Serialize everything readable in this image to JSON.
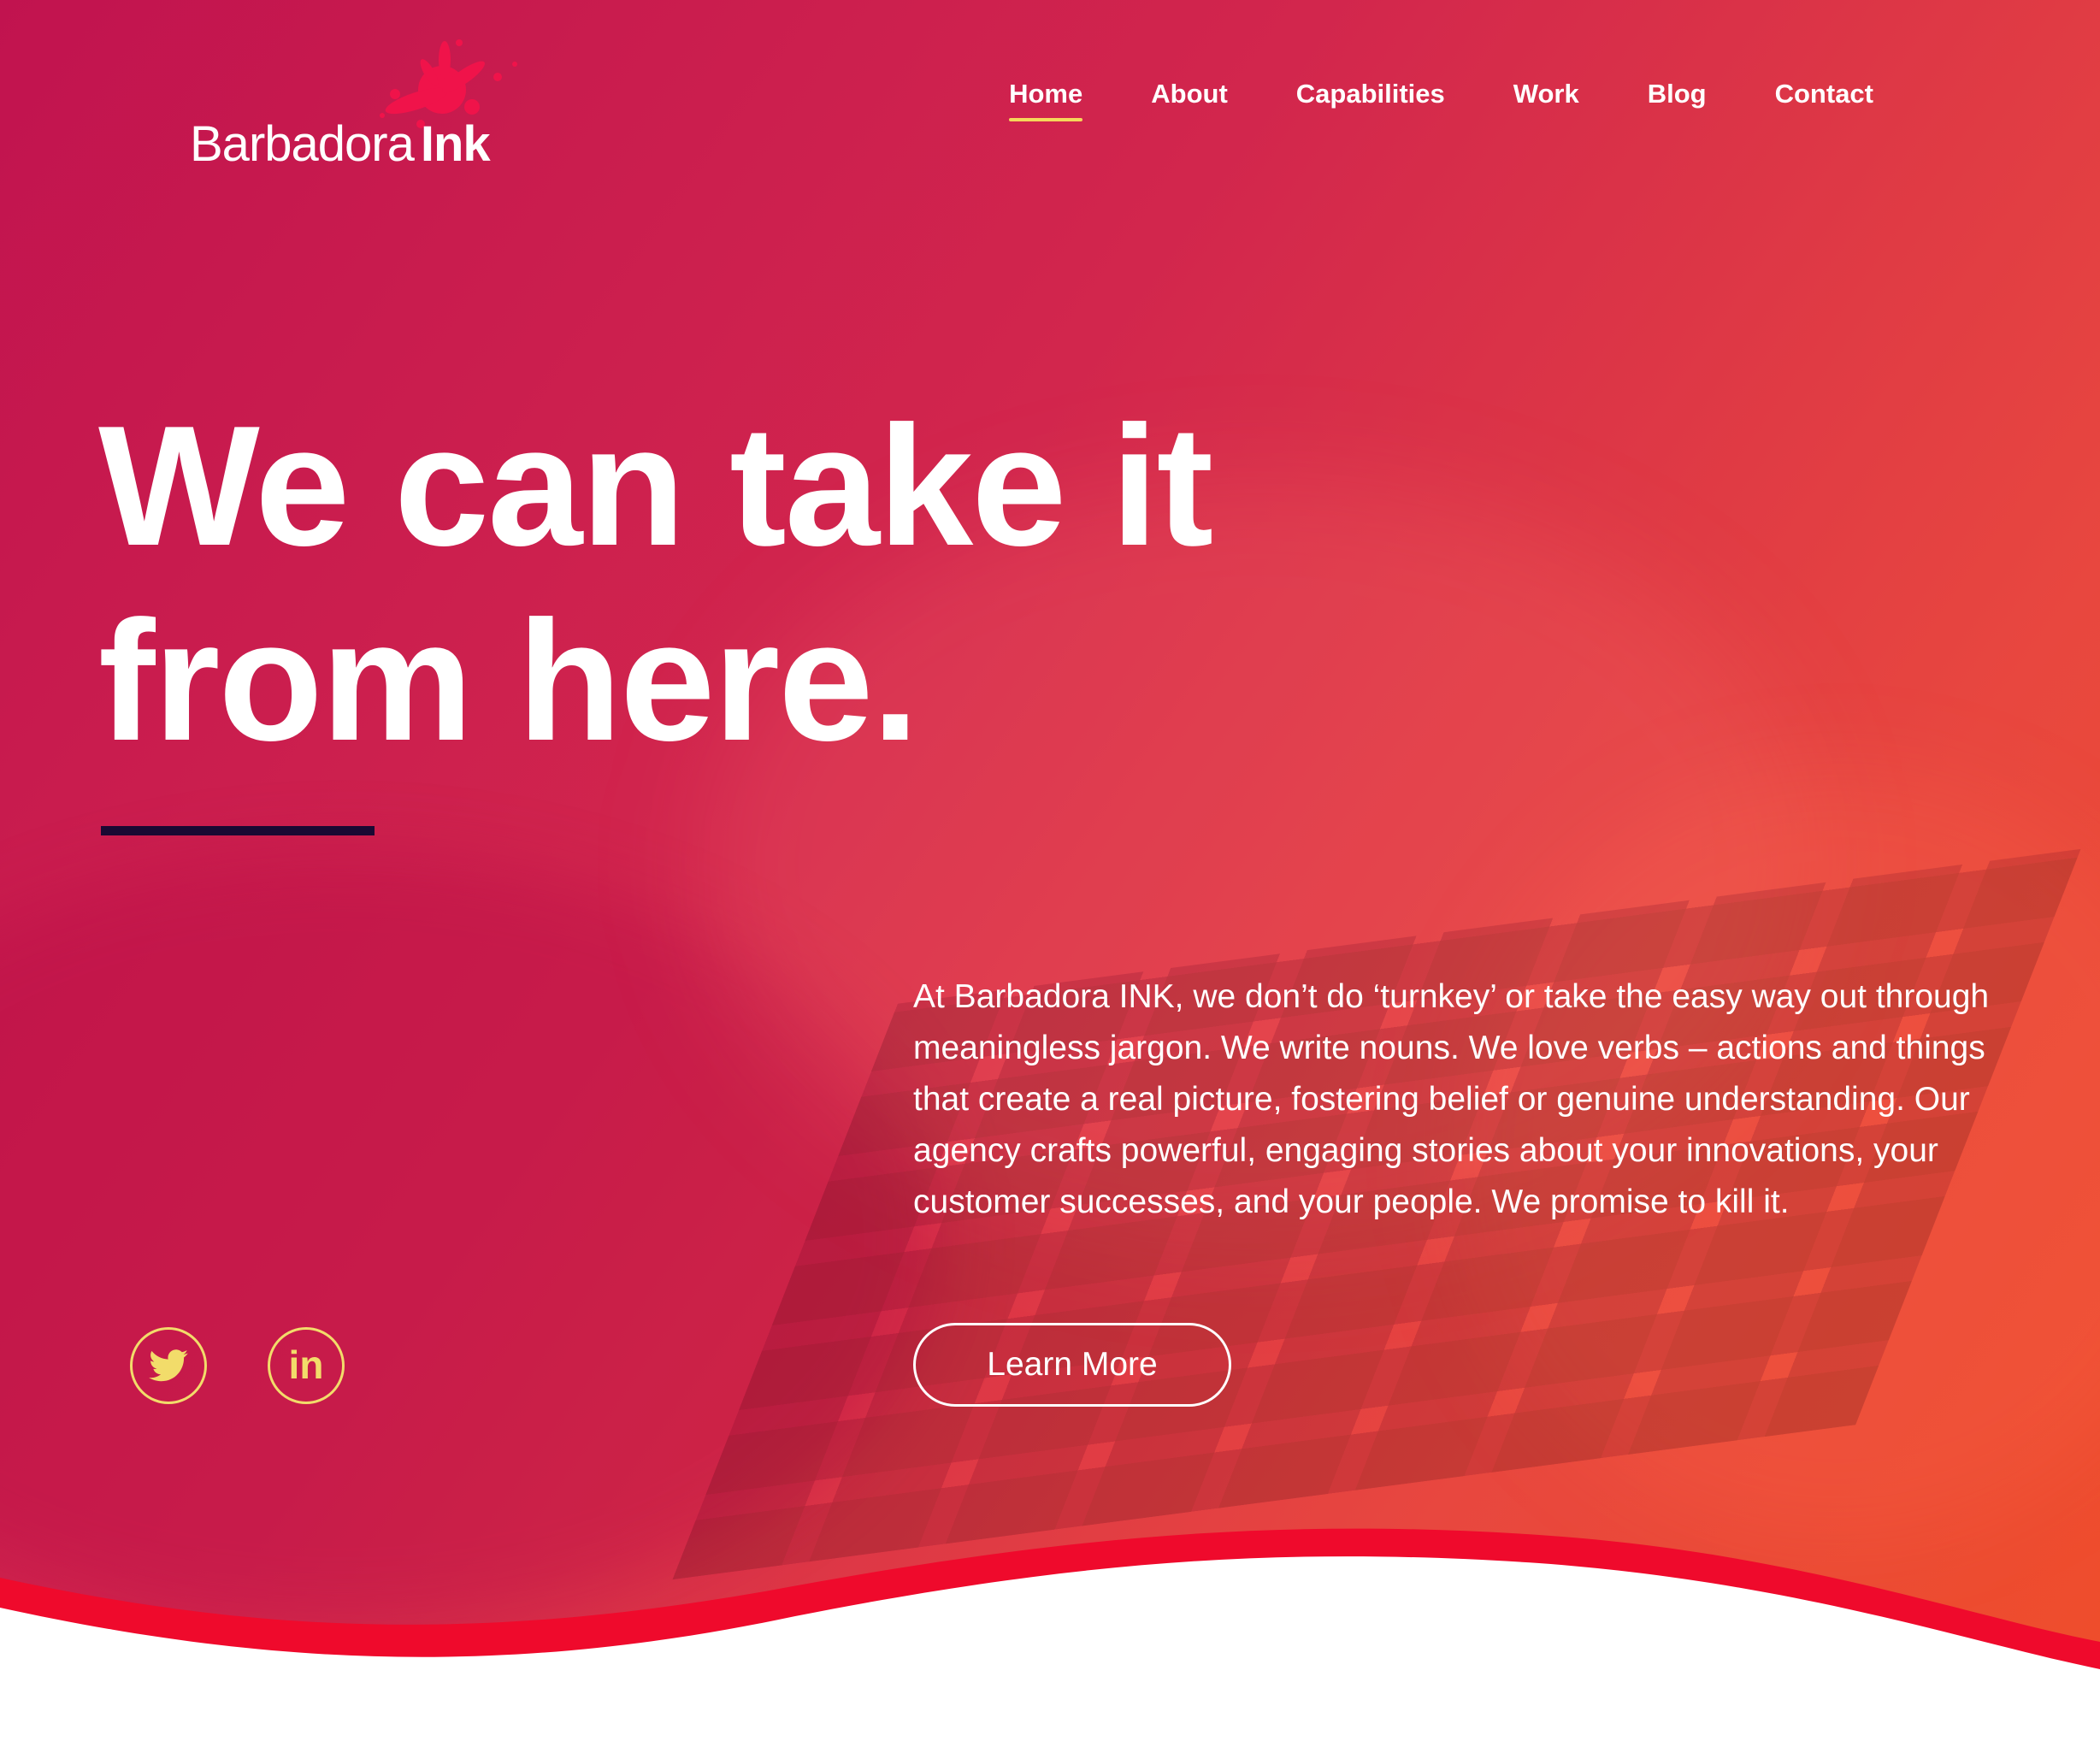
{
  "logo": {
    "light_text": "Barbadora",
    "bold_text": "Ink",
    "icon": "ink-splat-icon"
  },
  "nav": {
    "items": [
      {
        "label": "Home",
        "active": true
      },
      {
        "label": "About",
        "active": false
      },
      {
        "label": "Capabilities",
        "active": false
      },
      {
        "label": "Work",
        "active": false
      },
      {
        "label": "Blog",
        "active": false
      },
      {
        "label": "Contact",
        "active": false
      }
    ]
  },
  "hero": {
    "headline_line1": "We can take it",
    "headline_line2": "from here.",
    "body": "At Barbadora INK, we don’t do ‘turnkey’ or take the easy way out through meaningless jargon. We write nouns. We love verbs – actions and things that create a real picture, fostering belief or genuine understanding. Our agency crafts powerful, engaging stories about your innovations, your customer successes, and your people. We promise to kill it.",
    "cta_label": "Learn More"
  },
  "social": {
    "twitter_icon": "twitter-icon",
    "linkedin_icon": "linkedin-icon",
    "linkedin_glyph": "in"
  },
  "colors": {
    "accent_yellow": "#f2dc6a",
    "wave_red": "#ef0a2c",
    "divider": "#1a0933",
    "gradient_start": "#c1134f",
    "gradient_end": "#ef4e2a"
  }
}
